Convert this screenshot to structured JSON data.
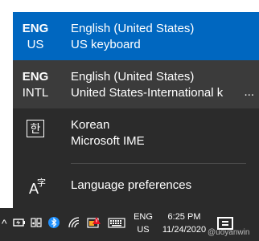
{
  "flyout": {
    "items": [
      {
        "abbr": "ENG",
        "sub": "US",
        "line1": "English (United States)",
        "line2": "US keyboard",
        "state": "selected"
      },
      {
        "abbr": "ENG",
        "sub": "INTL",
        "line1": "English (United States)",
        "line2": "United States-International k",
        "ellipsis": "...",
        "state": "hover"
      },
      {
        "glyph": "한",
        "line1": "Korean",
        "line2": "Microsoft IME",
        "state": "normal"
      }
    ],
    "preferences": {
      "icon_big": "A",
      "icon_small": "字",
      "label": "Language preferences"
    }
  },
  "taskbar": {
    "chevron": "^",
    "language": {
      "abbr": "ENG",
      "sub": "US"
    },
    "clock": {
      "time": "6:25 PM",
      "date": "11/24/2020"
    },
    "watermark": "@uoyanwin"
  },
  "colors": {
    "accent": "#0067c0",
    "background": "#2b2b2b",
    "hover": "#3b3b3b"
  }
}
